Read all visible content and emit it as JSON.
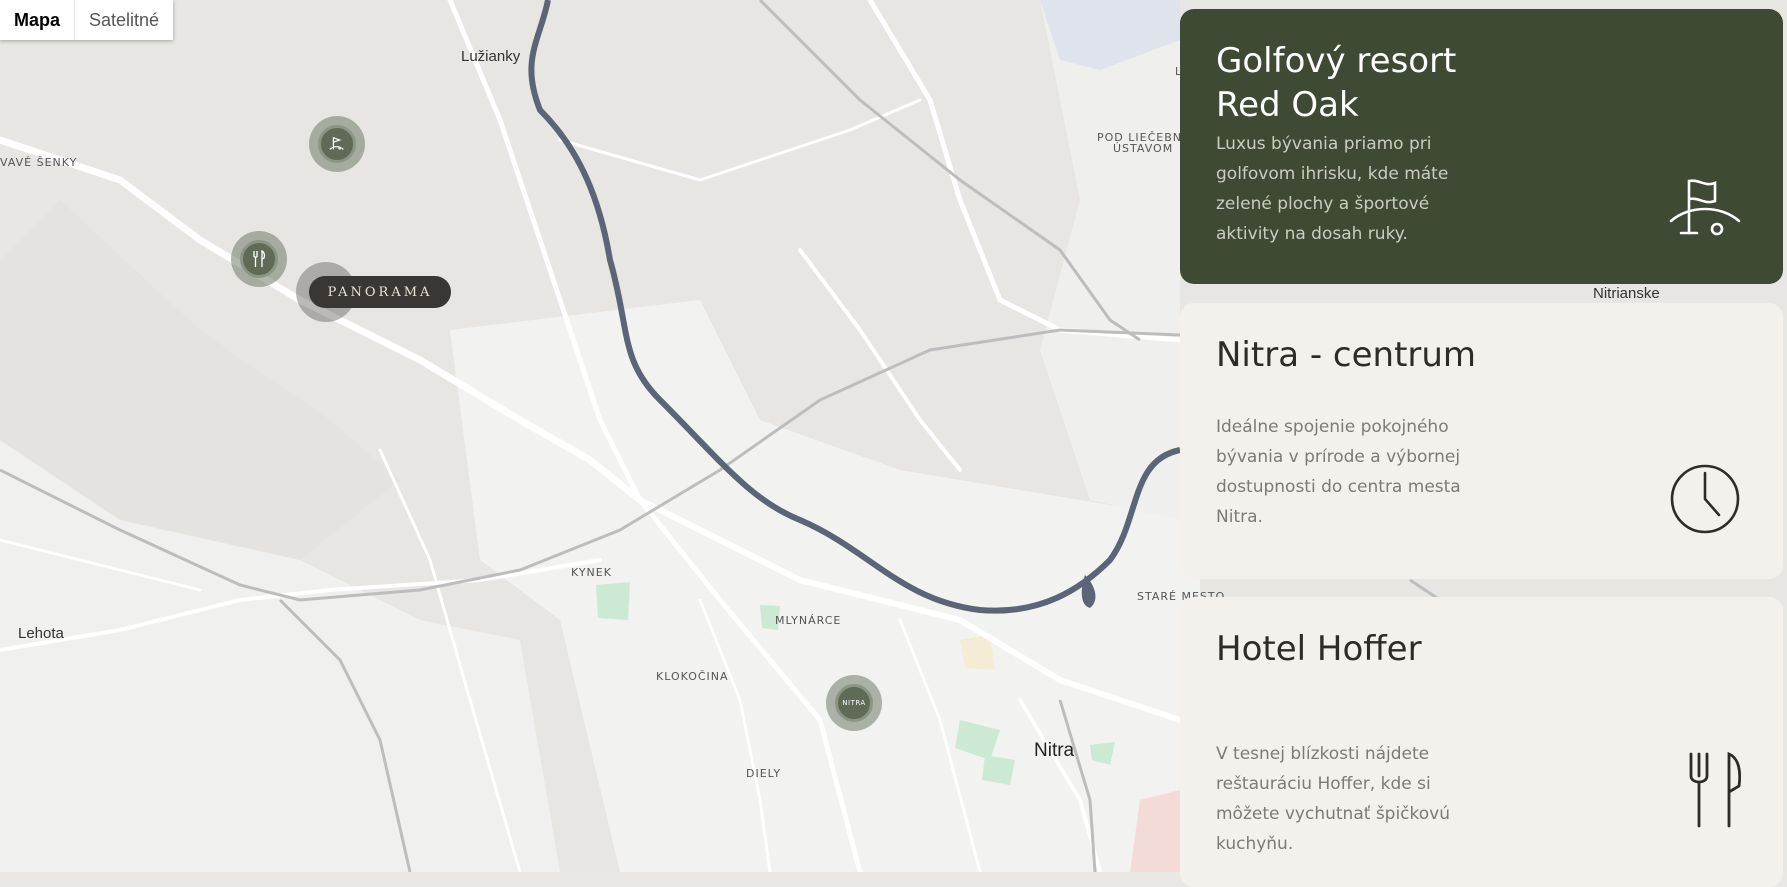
{
  "map_type": {
    "map": "Mapa",
    "satellite": "Satelitné",
    "selected": "Mapa"
  },
  "places": {
    "luzianky": "Lužianky",
    "nove_zamky_partial": "VAVÉ ŠENKY",
    "pod_liecebnym_ustavom_1": "POD LIEČEBNÝM",
    "pod_liecebnym_ustavom_2": "ÚSTAVOM",
    "nitrianske": "Nitrianske",
    "kynek": "KYNEK",
    "mlynarce": "MLYNÁRCE",
    "stare_mesto": "STARÉ MESTO",
    "lehota": "Lehota",
    "klokocina": "KLOKOČINA",
    "nitra": "Nitra",
    "diely": "DIELY",
    "partial_l": "L"
  },
  "markers": {
    "panorama": "PANORAMA",
    "nitra": "NITRA"
  },
  "cards": [
    {
      "title_line1": "Golfový resort",
      "title_line2": "Red Oak",
      "text": "Luxus bývania priamo pri golfovom ihrisku, kde máte zelené plochy a športové aktivity na dosah ruky.",
      "icon": "golf-flag-icon",
      "active": true
    },
    {
      "title_line1": "Nitra - centrum",
      "text": "Ideálne spojenie pokojného bývania v prírode a výbornej dostupnosti do centra mesta Nitra.",
      "icon": "clock-icon",
      "active": false
    },
    {
      "title_line1": "Hotel Hoffer",
      "text": "V tesnej blízkosti nájdete reštauráciu Hoffer, kde si môžete vychutnať špičkovú kuchyňu.",
      "icon": "fork-knife-icon",
      "active": false
    }
  ],
  "colors": {
    "active_card": "#3e4a34",
    "card": "#f4f1ed",
    "river": "#5b6577",
    "marker": "#5f6b57"
  }
}
